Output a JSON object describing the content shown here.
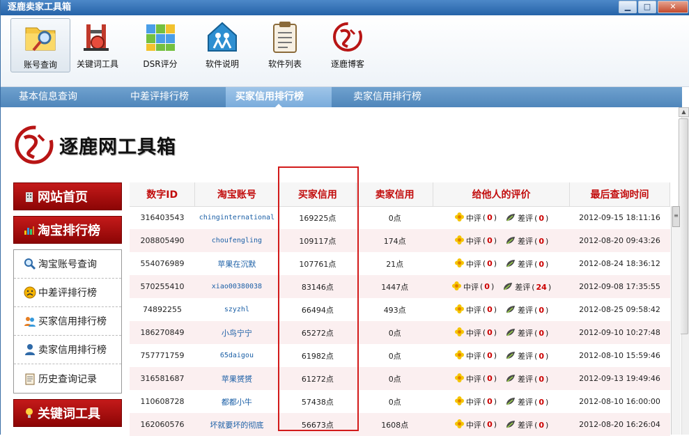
{
  "window": {
    "title": "逐鹿卖家工具箱",
    "min": "▁",
    "max": "□",
    "close": "✕"
  },
  "toolbar": [
    {
      "label": "账号查询",
      "icon": "folder-search-icon"
    },
    {
      "label": "关键词工具",
      "icon": "gym-machine-icon"
    },
    {
      "label": "DSR评分",
      "icon": "cube-icon"
    },
    {
      "label": "软件说明",
      "icon": "house-people-icon"
    },
    {
      "label": "软件列表",
      "icon": "clipboard-icon"
    },
    {
      "label": "逐鹿博客",
      "icon": "seal-logo-icon"
    }
  ],
  "tabs": [
    "基本信息查询",
    "中差评排行榜",
    "买家信用排行榜",
    "卖家信用排行榜"
  ],
  "active_tab": 2,
  "logo": {
    "text": "逐鹿网工具箱"
  },
  "sidebar": {
    "home": "网站首页",
    "ranking": "淘宝排行榜",
    "items": [
      "淘宝账号查询",
      "中差评排行榜",
      "买家信用排行榜",
      "卖家信用排行榜",
      "历史查询记录"
    ],
    "keyword": "关键词工具"
  },
  "table": {
    "headers": [
      "数字ID",
      "淘宝账号",
      "买家信用",
      "卖家信用",
      "给他人的评价",
      "最后查询时间"
    ],
    "mid_label": "中评",
    "bad_label": "差评",
    "rows": [
      {
        "id": "316403543",
        "acct": "chinginternational",
        "buyer": "169225点",
        "seller": "0点",
        "mid": "0",
        "bad": "0",
        "time": "2012-09-15 18:11:16",
        "mono": true
      },
      {
        "id": "208805490",
        "acct": "choufengling",
        "buyer": "109117点",
        "seller": "174点",
        "mid": "0",
        "bad": "0",
        "time": "2012-08-20 09:43:26",
        "mono": true
      },
      {
        "id": "554076989",
        "acct": "苹果在沉默",
        "buyer": "107761点",
        "seller": "21点",
        "mid": "0",
        "bad": "0",
        "time": "2012-08-24 18:36:12",
        "mono": false
      },
      {
        "id": "570255410",
        "acct": "xiao00380038",
        "buyer": "83146点",
        "seller": "1447点",
        "mid": "0",
        "bad": "24",
        "time": "2012-09-08 17:35:55",
        "mono": true
      },
      {
        "id": "74892255",
        "acct": "szyzhl",
        "buyer": "66494点",
        "seller": "493点",
        "mid": "0",
        "bad": "0",
        "time": "2012-08-25 09:58:42",
        "mono": true
      },
      {
        "id": "186270849",
        "acct": "小鸟宁宁",
        "buyer": "65272点",
        "seller": "0点",
        "mid": "0",
        "bad": "0",
        "time": "2012-09-10 10:27:48",
        "mono": false
      },
      {
        "id": "757771759",
        "acct": "65daigou",
        "buyer": "61982点",
        "seller": "0点",
        "mid": "0",
        "bad": "0",
        "time": "2012-08-10 15:59:46",
        "mono": true
      },
      {
        "id": "316581687",
        "acct": "苹果赟赟",
        "buyer": "61272点",
        "seller": "0点",
        "mid": "0",
        "bad": "0",
        "time": "2012-09-13 19:49:46",
        "mono": false
      },
      {
        "id": "110608728",
        "acct": "都都小牛",
        "buyer": "57438点",
        "seller": "0点",
        "mid": "0",
        "bad": "0",
        "time": "2012-08-10 16:00:00",
        "mono": false
      },
      {
        "id": "162060576",
        "acct": "坏就要坏的彻底",
        "buyer": "56673点",
        "seller": "1608点",
        "mid": "0",
        "bad": "0",
        "time": "2012-08-20 16:26:04",
        "mono": false
      }
    ]
  },
  "colors": {
    "accent_red": "#c20d0d",
    "tab_blue": "#5b91c4",
    "link_blue": "#1b5fa6",
    "highlight": "#d21a1a"
  }
}
